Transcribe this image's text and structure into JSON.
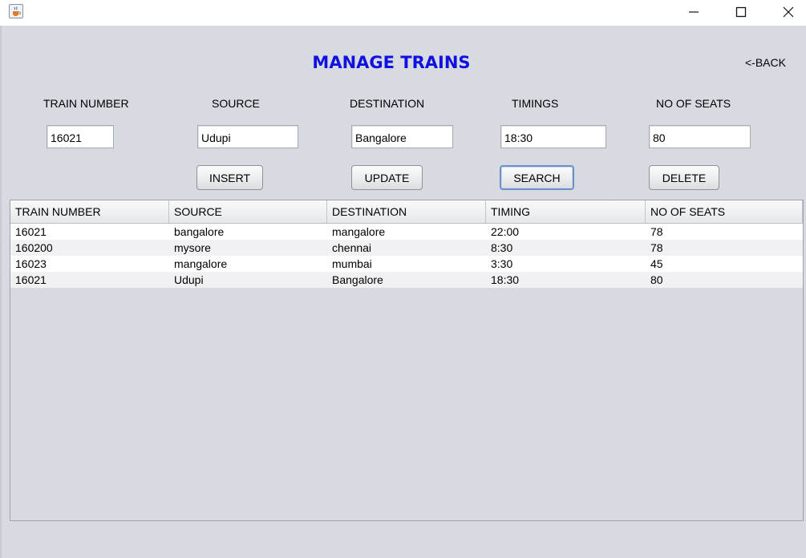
{
  "window": {
    "icon": "java-coffee-cup-icon",
    "controls": {
      "minimize": "minimize-icon",
      "maximize": "maximize-icon",
      "close": "close-icon"
    }
  },
  "header": {
    "title": "MANAGE TRAINS",
    "back_label": "<-BACK"
  },
  "form": {
    "fields": [
      {
        "label": "TRAIN NUMBER",
        "value": "16021"
      },
      {
        "label": "SOURCE",
        "value": "Udupi"
      },
      {
        "label": "DESTINATION",
        "value": "Bangalore"
      },
      {
        "label": "TIMINGS",
        "value": "18:30"
      },
      {
        "label": "NO OF SEATS",
        "value": "80"
      }
    ],
    "buttons": {
      "insert": "INSERT",
      "update": "UPDATE",
      "search": "SEARCH",
      "delete": "DELETE"
    }
  },
  "table": {
    "columns": [
      "TRAIN NUMBER",
      "SOURCE",
      "DESTINATION",
      "TIMING",
      "NO OF SEATS"
    ],
    "rows": [
      [
        "16021",
        "bangalore",
        "mangalore",
        "22:00",
        "78"
      ],
      [
        "160200",
        "mysore",
        "chennai",
        "8:30",
        "78"
      ],
      [
        "16023",
        "mangalore",
        "mumbai",
        "3:30",
        "45"
      ],
      [
        "16021",
        "Udupi",
        "Bangalore",
        "18:30",
        "80"
      ]
    ]
  },
  "colors": {
    "title": "#1010e0",
    "background": "#d7dae1",
    "focus_border": "#6d8fc4"
  }
}
